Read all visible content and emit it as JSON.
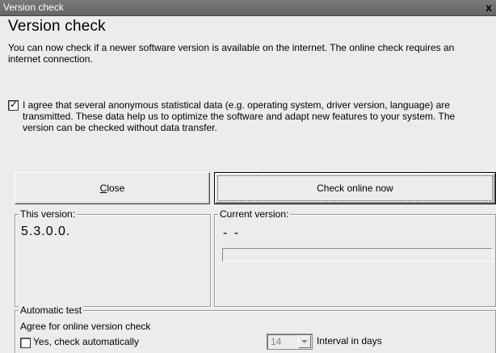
{
  "window": {
    "title": "Version check",
    "close_glyph": "x"
  },
  "heading": "Version check",
  "intro": "You can now check if a newer software version is available on the internet. The online check requires an internet connection.",
  "agree": {
    "checked": true,
    "text": "I agree that several anonymous statistical data (e.g. operating system, driver version, language) are transmitted. These data help us to optimize the software and adapt new features to your system. The version can be checked without data transfer."
  },
  "buttons": {
    "close_label_underlined": "C",
    "close_label_rest": "lose",
    "check_online_label": "Check online now"
  },
  "this_version": {
    "legend": "This version:",
    "value": "5.3.0.0."
  },
  "current_version": {
    "legend": "Current version:",
    "value": "- -",
    "progress": 0
  },
  "automatic_test": {
    "legend": "Automatic test",
    "agree_label": "Agree for online version check",
    "auto_checkbox_label": "Yes, check automatically",
    "auto_checked": false,
    "interval_value": "14",
    "interval_label": "Interval in days"
  },
  "icons": {
    "close": "close-icon",
    "check": "check-mark-icon",
    "dropdown": "chevron-down-icon"
  },
  "colors": {
    "titlebar": "#6e6e6e",
    "background": "#ececec"
  }
}
